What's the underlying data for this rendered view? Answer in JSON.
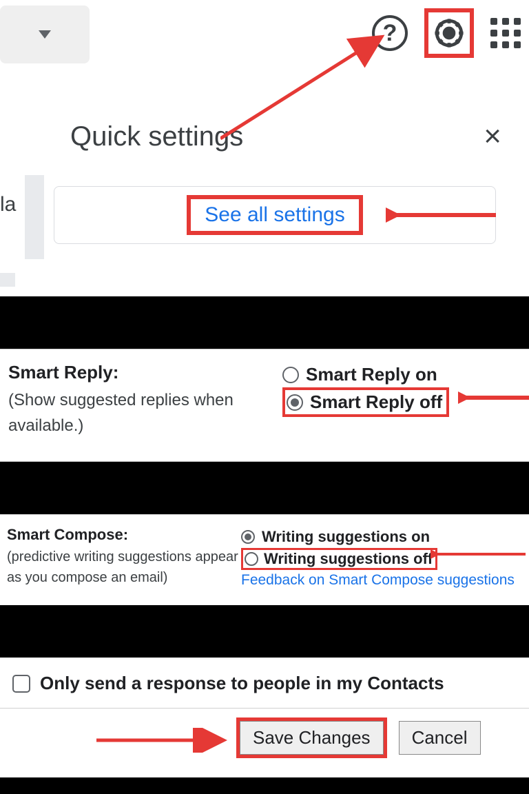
{
  "top": {
    "fragment_text": "la"
  },
  "quick_settings": {
    "title": "Quick settings",
    "see_all_label": "See all settings"
  },
  "smart_reply": {
    "title": "Smart Reply:",
    "description": "(Show suggested replies when available.)",
    "option_on": "Smart Reply on",
    "option_off": "Smart Reply off",
    "selected": "off"
  },
  "smart_compose": {
    "title": "Smart Compose:",
    "description": "(predictive writing suggestions appear as you compose an email)",
    "option_on": "Writing suggestions on",
    "option_off": "Writing suggestions off",
    "feedback_link": "Feedback on Smart Compose suggestions",
    "selected": "on"
  },
  "vacation": {
    "checkbox_label": "Only send a response to people in my Contacts"
  },
  "actions": {
    "save_label": "Save Changes",
    "cancel_label": "Cancel"
  },
  "annotation_color": "#e53935"
}
